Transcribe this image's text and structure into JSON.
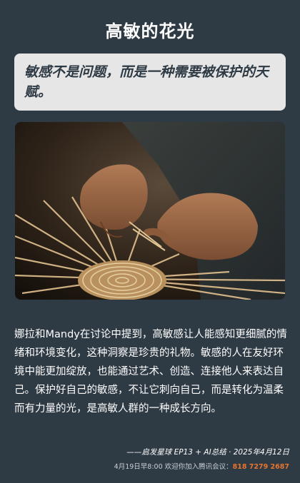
{
  "title": "高敏的花光",
  "quote": "敏感不是问题，而是一种需要被保护的天赋。",
  "image": {
    "description_icon": "basket-weaving-hands-photo"
  },
  "body": "娜拉和Mandy在讨论中提到，高敏感让人能感知更细腻的情绪和环境变化，这种洞察是珍贵的礼物。敏感的人在友好环境中能更加绽放，也能通过艺术、创造、连接他人来表达自己。保护好自己的敏感，不让它刺向自己，而是转化为温柔而有力量的光，是高敏人群的一种成长方向。",
  "credit": "——启发星球 EP13 + AI总结 · 2025年4月12日",
  "footer": {
    "prefix": "4月19日早8:00 欢迎你加入腾讯会议：",
    "phone": "818 7279 2687"
  },
  "colors": {
    "background": "#2e3a44",
    "quote_bg": "#e6e6e6",
    "accent": "#e8742d"
  }
}
